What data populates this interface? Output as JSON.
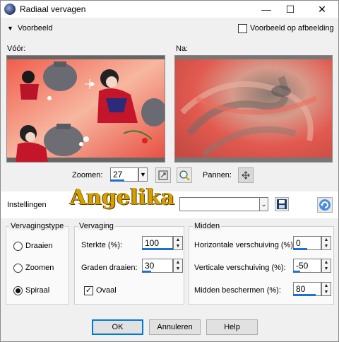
{
  "window": {
    "title": "Radiaal vervagen"
  },
  "preview_header": {
    "toggle_label": "Voorbeeld",
    "preview_on_image_label": "Voorbeeld op afbeelding",
    "preview_on_image_checked": false
  },
  "before_label": "Vóór:",
  "after_label": "Na:",
  "zoom": {
    "label": "Zoomen:",
    "value": "27"
  },
  "pan_label": "Pannen:",
  "settings": {
    "label": "Instellingen",
    "dropdown_value": ""
  },
  "watermark": "Angelika",
  "blur_type": {
    "title": "Vervagingstype",
    "options": [
      "Draaien",
      "Zoomen",
      "Spiraal"
    ],
    "selected": "Spiraal"
  },
  "blur": {
    "title": "Vervaging",
    "strength_label": "Sterkte (%):",
    "strength_value": "100",
    "strength_level": 1.0,
    "twist_label": "Graden draaien:",
    "twist_value": "30",
    "twist_level": 0.3,
    "elliptical_label": "Ovaal",
    "elliptical_checked": true
  },
  "center": {
    "title": "Midden",
    "h_label": "Horizontale verschuiving (%):",
    "h_value": "0",
    "h_level": 0.5,
    "v_label": "Verticale verschuiving (%):",
    "v_value": "-50",
    "v_level": 0.25,
    "protect_label": "Midden beschermen (%):",
    "protect_value": "80",
    "protect_level": 0.8
  },
  "buttons": {
    "ok": "OK",
    "cancel": "Annuleren",
    "help": "Help"
  },
  "colors": {
    "accent": "#1f6fd0",
    "preview_red": "#ea3b3b"
  }
}
